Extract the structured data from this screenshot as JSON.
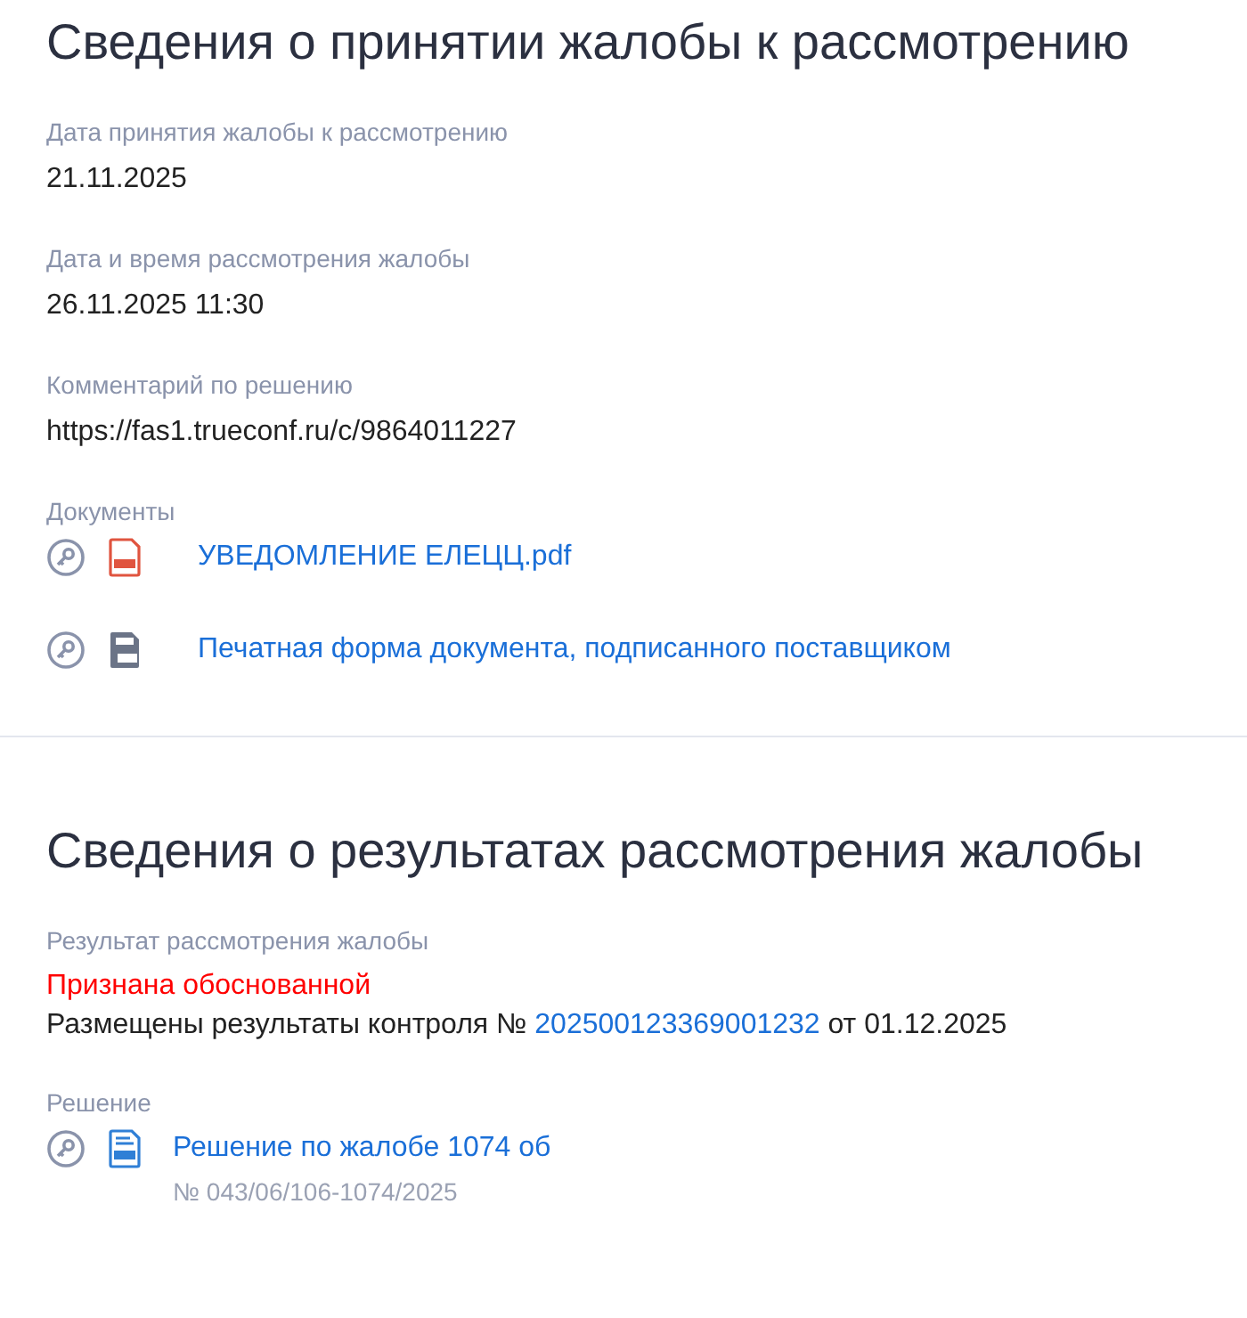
{
  "sections": [
    {
      "title": "Сведения о принятии жалобы к рассмотрению",
      "fields": [
        {
          "kind": "text",
          "label": "Дата принятия жалобы к рассмотрению",
          "value": "21.11.2025"
        },
        {
          "kind": "text",
          "label": "Дата и время рассмотрения жалобы",
          "value": "26.11.2025 11:30"
        },
        {
          "kind": "text",
          "label": "Комментарий по решению",
          "value": "https://fas1.trueconf.ru/c/9864011227"
        },
        {
          "kind": "documents",
          "label": "Документы",
          "documents": [
            {
              "kind": "pdf",
              "name": "УВЕДОМЛЕНИЕ ЕЛЕЦЦ.pdf"
            },
            {
              "kind": "txt",
              "name": "Печатная форма документа, подписанного поставщиком"
            }
          ]
        }
      ]
    },
    {
      "title": "Сведения о результатах рассмотрения жалобы",
      "fields": [
        {
          "kind": "result",
          "label": "Результат рассмотрения жалобы",
          "status": "Признана обоснованной",
          "text_before": "Размещены результаты контроля № ",
          "link": "202500123369001232",
          "text_after": " от 01.12.2025"
        },
        {
          "kind": "documents",
          "label": "Решение",
          "documents": [
            {
              "kind": "docx",
              "name": "Решение по жалобе 1074 об",
              "number": "№ 043/06/106-1074/2025"
            }
          ]
        }
      ]
    }
  ]
}
